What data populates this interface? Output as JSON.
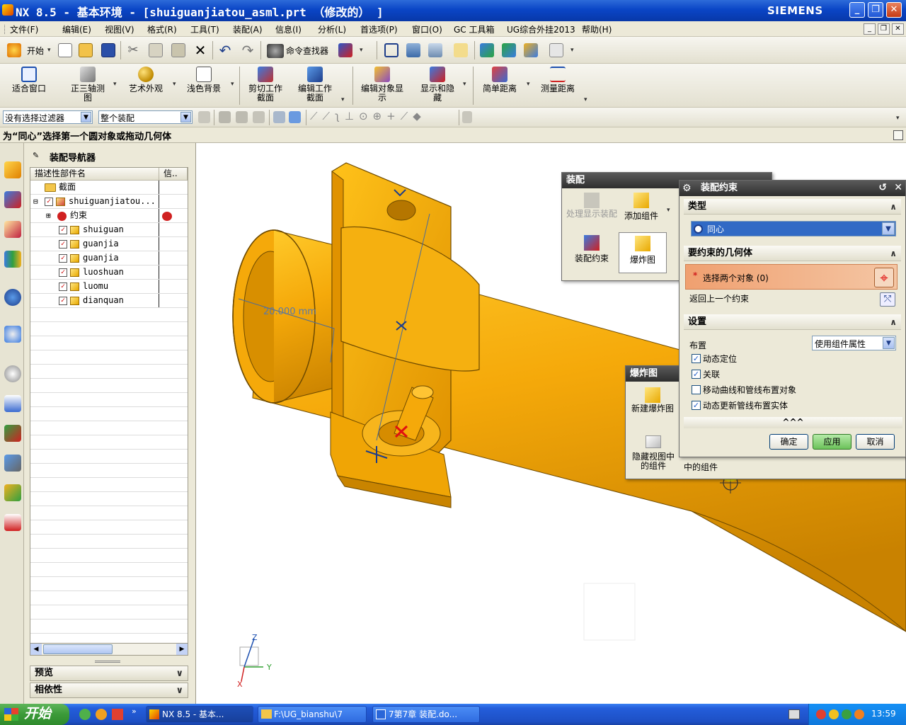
{
  "window": {
    "title": "NX 8.5 - 基本环境 - [shuiguanjiatou_asml.prt （修改的） ]",
    "brand": "SIEMENS",
    "controls": [
      "_",
      "❐",
      "✕"
    ]
  },
  "menu": {
    "items": [
      "文件(F)",
      "编辑(E)",
      "视图(V)",
      "格式(R)",
      "工具(T)",
      "装配(A)",
      "信息(I)",
      "分析(L)",
      "首选项(P)",
      "窗口(O)",
      "GC 工具箱",
      "UG综合外挂2013",
      "帮助(H)"
    ]
  },
  "toolbar1": {
    "start_label": "开始",
    "command_finder_label": "命令查找器"
  },
  "toolbar2": {
    "buttons": [
      "适合窗口",
      "正三轴测图",
      "艺术外观",
      "浅色背景",
      "剪切工作截面",
      "编辑工作截面",
      "编辑对象显示",
      "显示和隐藏",
      "简单距离",
      "测量距离"
    ]
  },
  "filter": {
    "selection_filter": "没有选择过滤器",
    "scope": "整个装配"
  },
  "cue_line": "为“同心”选择第一个圆对象或拖动几何体",
  "navigator": {
    "title": "装配导航器",
    "col_name": "描述性部件名",
    "col_info": "信..",
    "section_folder": "截面",
    "root": "shuiguanjiatou...",
    "constraints": "约束",
    "parts": [
      "shuiguan",
      "guanjia",
      "guanjia",
      "luoshuan",
      "luomu",
      "dianquan"
    ],
    "preview_label": "预览",
    "dependency_label": "相依性"
  },
  "viewport": {
    "dimension_label": "20.000 mm",
    "axis_x": "X",
    "axis_y": "Y",
    "axis_z": "Z"
  },
  "assembly_toolbar": {
    "title": "装配",
    "items": [
      "处理显示装配",
      "添加组件",
      "装配约束",
      "爆炸图"
    ]
  },
  "explode_toolbar": {
    "title": "爆炸图",
    "items": [
      "新建爆炸图",
      "隐藏视图中的组件"
    ],
    "hidden_label": "中的组件"
  },
  "constraint_dialog": {
    "title": "装配约束",
    "type_section": "类型",
    "type_value": "同心",
    "geometry_section": "要约束的几何体",
    "select_objects": "选择两个对象 (0)",
    "required_mark": "*",
    "back_constraint": "返回上一个约束",
    "settings_section": "设置",
    "layout_label": "布置",
    "layout_value": "使用组件属性",
    "options": [
      {
        "label": "动态定位",
        "checked": true
      },
      {
        "label": "关联",
        "checked": true
      },
      {
        "label": "移动曲线和管线布置对象",
        "checked": false
      },
      {
        "label": "动态更新管线布置实体",
        "checked": true
      }
    ],
    "more": "^^^",
    "ok": "确定",
    "apply": "应用",
    "cancel": "取消"
  },
  "taskbar": {
    "start": "开始",
    "tasks": [
      "NX 8.5 - 基本...",
      "F:\\UG_bianshu\\7",
      "7第7章 装配.do..."
    ],
    "time": "13:59"
  },
  "colors": {
    "part_orange": "#f5a90a",
    "titlebar_blue": "#0a45c6",
    "dialog_title": "#2e2e2e",
    "selection_highlight": "#f0a070"
  }
}
